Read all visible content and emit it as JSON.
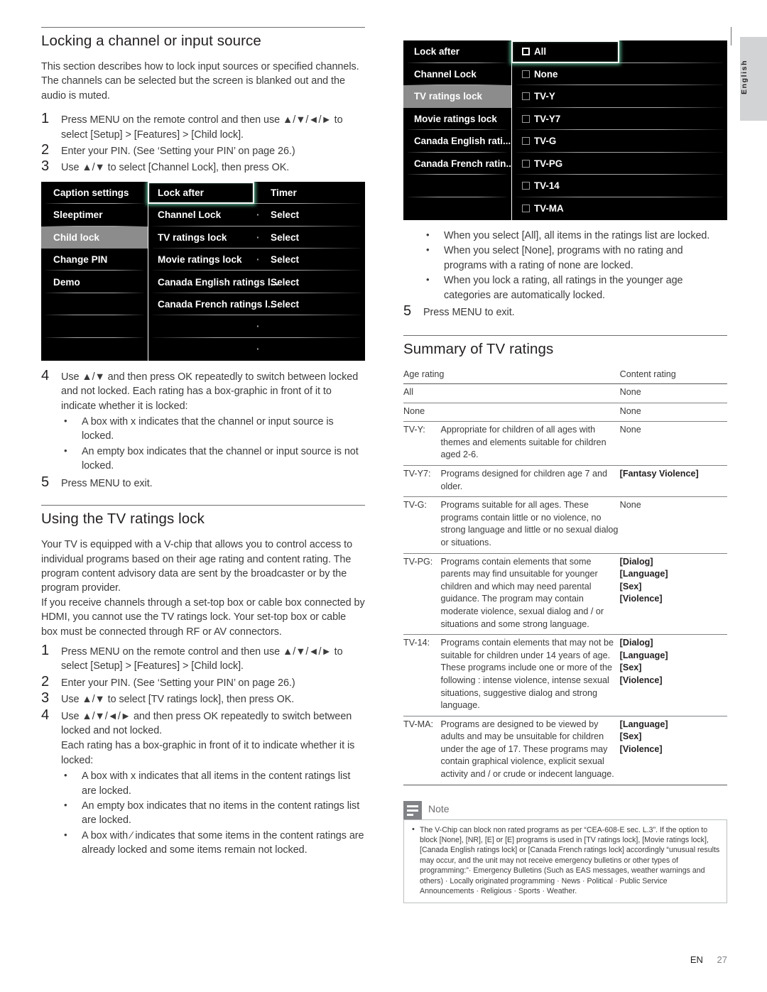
{
  "page": {
    "language_tab": "English",
    "footer_lang": "EN",
    "footer_page": "27"
  },
  "left_column": {
    "section1": {
      "title": "Locking a channel or input source",
      "intro": "This section describes how to lock input sources or specified channels. The channels can be selected but the screen is blanked out and the audio is muted.",
      "steps": [
        {
          "num": "1",
          "text": "Press MENU on the remote control and then use ▲/▼/◄/► to select [Setup] > [Features] > [Child lock]."
        },
        {
          "num": "2",
          "text": "Enter your PIN. (See ‘Setting your PIN’ on page 26.)"
        },
        {
          "num": "3",
          "text": "Use ▲/▼ to select [Channel Lock], then press OK."
        }
      ],
      "step4": {
        "num": "4",
        "text": "Use ▲/▼ and then press OK repeatedly to switch between locked and not locked. Each rating has a box-graphic in front of it to indicate whether it is locked:",
        "bullets": [
          "A box with x indicates that the channel or input source is locked.",
          "An empty box indicates that the channel or input source is not locked."
        ]
      },
      "step5": {
        "num": "5",
        "text": "Press MENU to exit."
      }
    },
    "osd1": {
      "left_pane": [
        {
          "label": "Caption settings",
          "selected": false
        },
        {
          "label": "Sleeptimer",
          "selected": false
        },
        {
          "label": "Child lock",
          "selected": true
        },
        {
          "label": "Change PIN",
          "selected": false
        },
        {
          "label": "Demo",
          "selected": false
        },
        {
          "label": "",
          "selected": false
        },
        {
          "label": "",
          "selected": false
        },
        {
          "label": "",
          "selected": false
        }
      ],
      "mid_pane": [
        {
          "label": "Lock after",
          "value": "Timer",
          "dot": "",
          "highlighted": true
        },
        {
          "label": "Channel Lock",
          "value": "Select",
          "dot": "·",
          "highlighted": false
        },
        {
          "label": "TV ratings lock",
          "value": "Select",
          "dot": "·",
          "highlighted": false
        },
        {
          "label": "Movie ratings lock",
          "value": "Select",
          "dot": "·",
          "highlighted": false
        },
        {
          "label": "Canada English ratings l...",
          "value": "Select",
          "dot": "·",
          "highlighted": false
        },
        {
          "label": "Canada French ratings l...",
          "value": "Select",
          "dot": "·",
          "highlighted": false
        },
        {
          "label": "",
          "value": "",
          "dot": "·",
          "highlighted": false
        },
        {
          "label": "",
          "value": "",
          "dot": "·",
          "highlighted": false
        }
      ]
    },
    "section2": {
      "title": "Using the TV ratings lock",
      "para1": "Your TV is equipped with a V-chip that allows you to control access to individual programs based on their age rating and content rating. The program content advisory data are sent by the broadcaster or by the program provider.",
      "para2": "If you receive channels through a set-top box or cable box connected by HDMI, you cannot use the TV ratings lock. Your set-top box or cable box must be connected through RF or AV connectors.",
      "steps": [
        {
          "num": "1",
          "text": "Press MENU on the remote control and then use ▲/▼/◄/► to select [Setup] > [Features] > [Child lock]."
        },
        {
          "num": "2",
          "text": "Enter your PIN. (See ‘Setting your PIN’ on page 26.)"
        },
        {
          "num": "3",
          "text": "Use ▲/▼ to select [TV ratings lock], then press OK."
        },
        {
          "num": "4",
          "text": "Use ▲/▼/◄/► and then press OK repeatedly to switch between locked and not locked."
        }
      ],
      "continuation": "Each rating has a box-graphic in front of it to indicate whether it is locked:",
      "bullets": [
        "A box with x indicates that all items in the content ratings list are locked.",
        "An empty box indicates that no items in the content ratings list are locked.",
        "A box with ∕ indicates that some items in the content ratings are already locked and some items remain not locked."
      ]
    }
  },
  "right_column": {
    "osd2": {
      "left_pane": [
        {
          "label": "Lock after",
          "selected": false
        },
        {
          "label": "Channel Lock",
          "selected": false
        },
        {
          "label": "TV ratings lock",
          "selected": true
        },
        {
          "label": "Movie ratings lock",
          "selected": false
        },
        {
          "label": "Canada English rati...",
          "selected": false
        },
        {
          "label": "Canada French ratin...",
          "selected": false
        },
        {
          "label": "",
          "selected": false
        },
        {
          "label": "",
          "selected": false
        }
      ],
      "mid_pane": [
        {
          "label": "All",
          "checked": false,
          "highlighted": true
        },
        {
          "label": "None",
          "checked": false,
          "highlighted": false
        },
        {
          "label": "TV-Y",
          "checked": false,
          "highlighted": false
        },
        {
          "label": "TV-Y7",
          "checked": false,
          "highlighted": false
        },
        {
          "label": "TV-G",
          "checked": false,
          "highlighted": false
        },
        {
          "label": "TV-PG",
          "checked": false,
          "highlighted": false
        },
        {
          "label": "TV-14",
          "checked": false,
          "highlighted": false
        },
        {
          "label": "TV-MA",
          "checked": false,
          "highlighted": false
        }
      ]
    },
    "bullets": [
      "When you select [All], all items in the ratings list are locked.",
      "When you select [None], programs with no rating and programs with a rating of none are locked.",
      "When you lock a rating, all ratings in the younger age categories are automatically locked."
    ],
    "step5": {
      "num": "5",
      "text": "Press MENU to exit."
    },
    "summary": {
      "title": "Summary of TV ratings",
      "headers": {
        "age": "Age rating",
        "content": "Content rating"
      },
      "rows": [
        {
          "age": "All",
          "desc": "",
          "content": "None"
        },
        {
          "age": "None",
          "desc": "",
          "content": "None"
        },
        {
          "age": "TV-Y:",
          "desc": "Appropriate for children of all ages with themes and elements suitable for children aged 2-6.",
          "content": "None"
        },
        {
          "age": "TV-Y7:",
          "desc": "Programs designed for children age 7 and older.",
          "content": "[Fantasy Violence]"
        },
        {
          "age": "TV-G:",
          "desc": "Programs suitable for all ages. These programs contain little or no violence, no strong language and little or no sexual dialog or situations.",
          "content": "None"
        },
        {
          "age": "TV-PG:",
          "desc": "Programs contain elements that some parents may find unsuitable for younger children and which may need parental guidance. The program may contain moderate violence, sexual dialog and / or situations and some strong language.",
          "content": "[Dialog]\n[Language]\n[Sex]\n[Violence]"
        },
        {
          "age": "TV-14:",
          "desc": "Programs contain elements that may not be suitable for children under 14 years of age. These programs include one or more of the following : intense violence, intense sexual situations, suggestive dialog and strong language.",
          "content": "[Dialog]\n[Language]\n[Sex]\n[Violence]"
        },
        {
          "age": "TV-MA:",
          "desc": "Programs are designed to be viewed by adults and may be unsuitable for children under the age of 17. These programs may contain graphical violence, explicit sexual activity and / or crude or indecent language.",
          "content": "[Language]\n[Sex]\n[Violence]"
        }
      ]
    },
    "note": {
      "title": "Note",
      "text": "The V-Chip can block non rated programs as per “CEA-608-E sec. L.3”. If the option to block [None], [NR], [E] or [E] programs is used in [TV ratings lock], [Movie ratings lock], [Canada English ratings lock] or [Canada French ratings lock] accordingly “unusual results may occur, and the unit may not receive emergency bulletins or other types of programming:”· Emergency Bulletins (Such as EAS messages, weather warnings and others) · Locally originated programming · News · Political · Public Service Announcements · Religious · Sports · Weather."
    }
  }
}
